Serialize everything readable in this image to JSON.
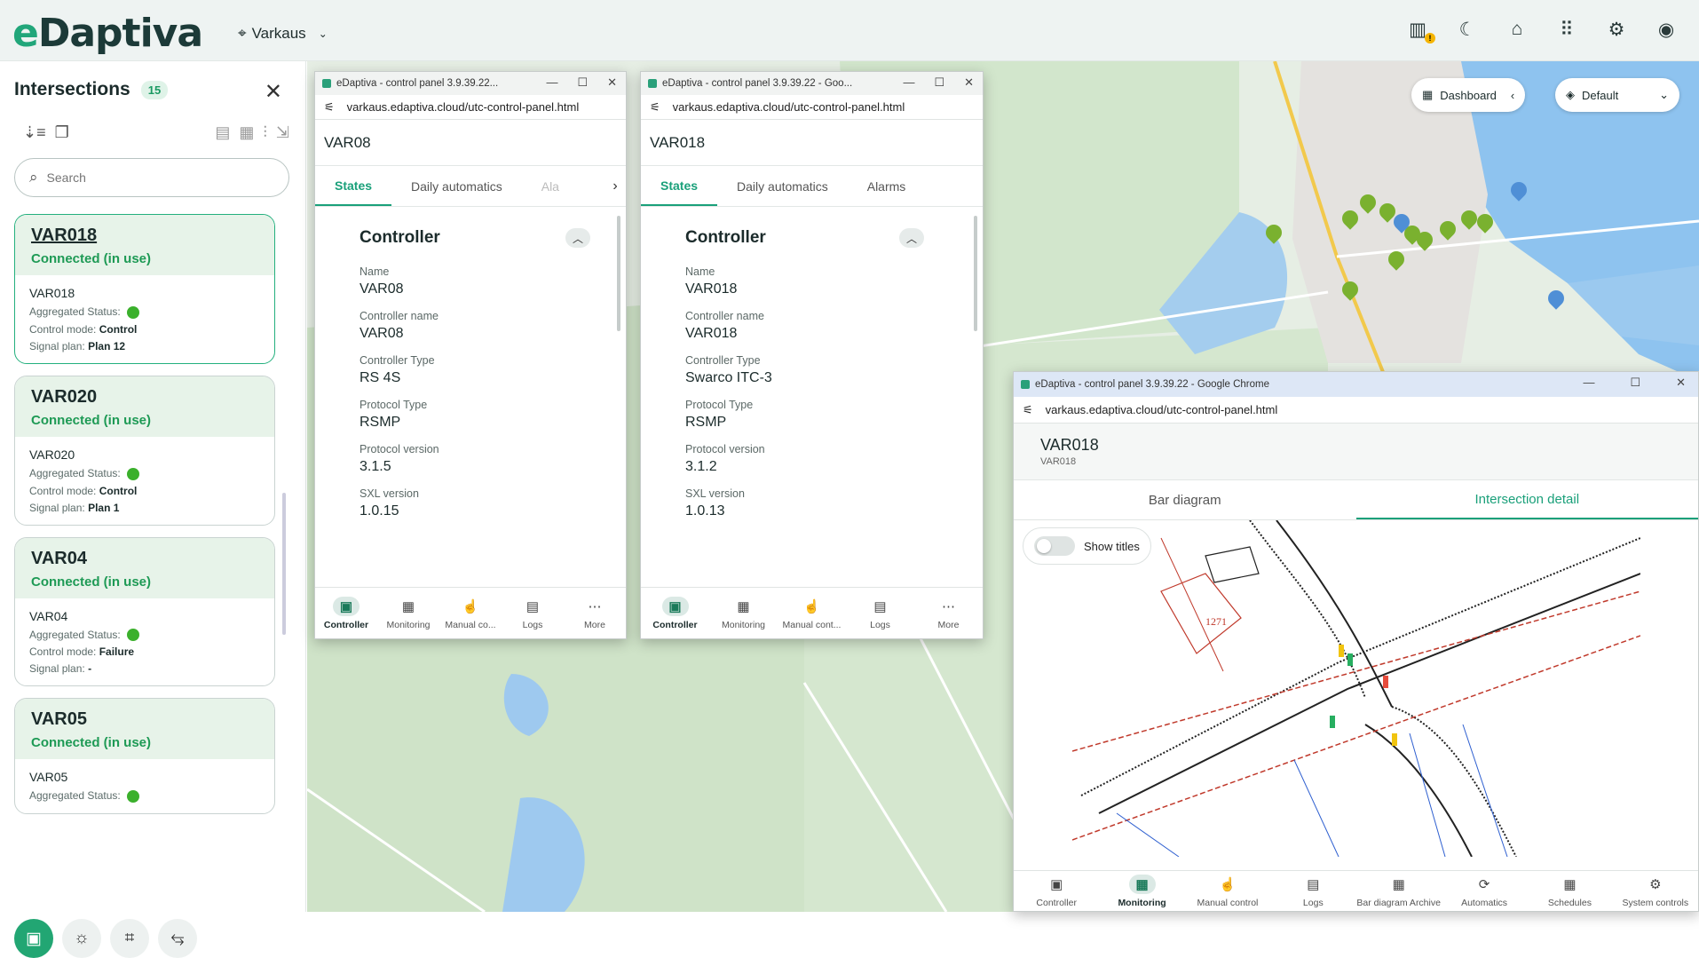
{
  "app": {
    "logo_e": "e",
    "logo_rest": "Daptiva",
    "location": "Varkaus"
  },
  "topbar": {
    "icons": [
      "traffic-map-icon",
      "moon-icon",
      "home-icon",
      "apps-grid-icon",
      "gear-icon",
      "account-icon"
    ],
    "warn_badge": "!"
  },
  "sidebar": {
    "title": "Intersections",
    "count": "15",
    "search_placeholder": "Search",
    "cards": [
      {
        "name": "VAR018",
        "status": "Connected (in use)",
        "label": "VAR018",
        "aggregated_label": "Aggregated Status:",
        "mode_label": "Control mode:",
        "mode": "Control",
        "plan_label": "Signal plan:",
        "plan": "Plan 12"
      },
      {
        "name": "VAR020",
        "status": "Connected (in use)",
        "label": "VAR020",
        "aggregated_label": "Aggregated Status:",
        "mode_label": "Control mode:",
        "mode": "Control",
        "plan_label": "Signal plan:",
        "plan": "Plan 1"
      },
      {
        "name": "VAR04",
        "status": "Connected (in use)",
        "label": "VAR04",
        "aggregated_label": "Aggregated Status:",
        "mode_label": "Control mode:",
        "mode": "Failure",
        "plan_label": "Signal plan:",
        "plan": "-"
      },
      {
        "name": "VAR05",
        "status": "Connected (in use)",
        "label": "VAR05",
        "aggregated_label": "Aggregated Status:"
      }
    ]
  },
  "map": {
    "dashboard_label": "Dashboard",
    "layer_label": "Default"
  },
  "win1": {
    "title": "eDaptiva - control panel 3.9.39.22...",
    "url": "varkaus.edaptiva.cloud/utc-control-panel.html",
    "header": "VAR08",
    "tabs": [
      "States",
      "Daily automatics",
      "Ala"
    ],
    "section": "Controller",
    "fields": [
      {
        "k": "Name",
        "v": "VAR08"
      },
      {
        "k": "Controller name",
        "v": "VAR08"
      },
      {
        "k": "Controller Type",
        "v": "RS 4S"
      },
      {
        "k": "Protocol Type",
        "v": "RSMP"
      },
      {
        "k": "Protocol version",
        "v": "3.1.5"
      },
      {
        "k": "SXL version",
        "v": "1.0.15"
      }
    ],
    "foot": [
      "Controller",
      "Monitoring",
      "Manual co...",
      "Logs",
      "More"
    ]
  },
  "win2": {
    "title": "eDaptiva - control panel 3.9.39.22 - Goo...",
    "url": "varkaus.edaptiva.cloud/utc-control-panel.html",
    "header": "VAR018",
    "tabs": [
      "States",
      "Daily automatics",
      "Alarms"
    ],
    "section": "Controller",
    "fields": [
      {
        "k": "Name",
        "v": "VAR018"
      },
      {
        "k": "Controller name",
        "v": "VAR018"
      },
      {
        "k": "Controller Type",
        "v": "Swarco ITC-3"
      },
      {
        "k": "Protocol Type",
        "v": "RSMP"
      },
      {
        "k": "Protocol version",
        "v": "3.1.2"
      },
      {
        "k": "SXL version",
        "v": "1.0.13"
      }
    ],
    "foot": [
      "Controller",
      "Monitoring",
      "Manual cont...",
      "Logs",
      "More"
    ]
  },
  "win3": {
    "title": "eDaptiva - control panel 3.9.39.22 - Google Chrome",
    "url": "varkaus.edaptiva.cloud/utc-control-panel.html",
    "header": "VAR018",
    "subheader": "VAR018",
    "tabs": [
      "Bar diagram",
      "Intersection detail"
    ],
    "toggle_label": "Show titles",
    "plan_number": "1271",
    "foot": [
      "Controller",
      "Monitoring",
      "Manual control",
      "Logs",
      "Bar diagram Archive",
      "Automatics",
      "Schedules",
      "System controls"
    ]
  }
}
